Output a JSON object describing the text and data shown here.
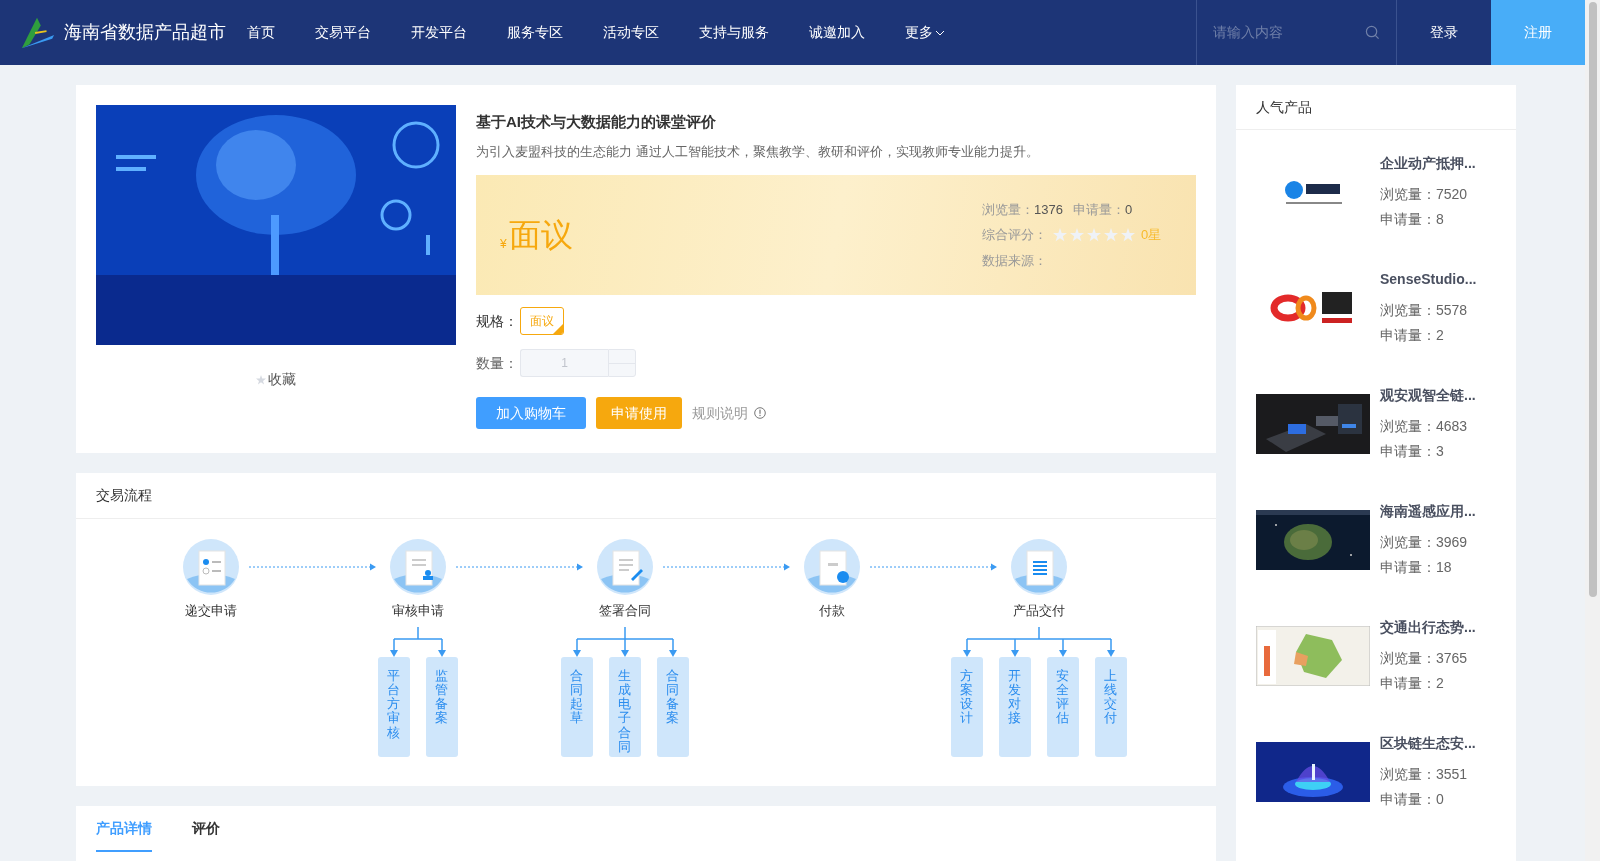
{
  "header": {
    "site_name": "海南省数据产品超市",
    "nav": [
      {
        "label": "首页",
        "has_caret": false
      },
      {
        "label": "交易平台",
        "has_caret": false
      },
      {
        "label": "开发平台",
        "has_caret": false
      },
      {
        "label": "服务专区",
        "has_caret": false
      },
      {
        "label": "活动专区",
        "has_caret": false
      },
      {
        "label": "支持与服务",
        "has_caret": false
      },
      {
        "label": "诚邀加入",
        "has_caret": false
      },
      {
        "label": "更多",
        "has_caret": true
      }
    ],
    "search": {
      "placeholder": "请输入内容"
    },
    "login": "登录",
    "register": "注册"
  },
  "product": {
    "title": "基于AI技术与大数据能力的课堂评价",
    "description": "为引入麦盟科技的生态能力 通过人工智能技术，聚焦教学、教研和评价，实现教师专业能力提升。",
    "price_symbol": "¥",
    "price": "面议",
    "views_label": "浏览量：",
    "views": "1376",
    "applies_label": "申请量：",
    "applies": "0",
    "rating_label": "综合评分：",
    "stars": 0,
    "rating_text": "0星",
    "source_label": "数据来源：",
    "spec_label": "规格：",
    "specs": [
      {
        "label": "面议",
        "selected": true
      }
    ],
    "quantity_label": "数量：",
    "quantity": "1",
    "favorite": "收藏",
    "buttons": [
      {
        "label": "加入购物车",
        "kind": "primary"
      },
      {
        "label": "申请使用",
        "kind": "warning"
      }
    ],
    "rules_link": "规则说明"
  },
  "flow": {
    "title": "交易流程",
    "steps": [
      {
        "label": "递交申请",
        "kind": "form"
      },
      {
        "label": "审核申请",
        "kind": "stamp",
        "children": [
          "平台方审核",
          "监管备案"
        ]
      },
      {
        "label": "签署合同",
        "kind": "pen",
        "children": [
          "合同起草",
          "生成电子合同",
          "合同备案"
        ]
      },
      {
        "label": "付款",
        "kind": "payment"
      },
      {
        "label": "产品交付",
        "kind": "list",
        "children": [
          "方案设计",
          "开发对接",
          "安全评估",
          "上线交付"
        ]
      }
    ]
  },
  "tabs": [
    {
      "label": "产品详情",
      "selected": true
    },
    {
      "label": "评价",
      "selected": false
    }
  ],
  "popular": {
    "title": "人气产品",
    "items": [
      {
        "name": "企业动产抵押...",
        "views": "浏览量：7520",
        "applies": "申请量：8"
      },
      {
        "name": "SenseStudio...",
        "views": "浏览量：5578",
        "applies": "申请量：2"
      },
      {
        "name": "观安观智全链...",
        "views": "浏览量：4683",
        "applies": "申请量：3"
      },
      {
        "name": "海南遥感应用...",
        "views": "浏览量：3969",
        "applies": "申请量：18"
      },
      {
        "name": "交通出行态势...",
        "views": "浏览量：3765",
        "applies": "申请量：2"
      },
      {
        "name": "区块链生态安...",
        "views": "浏览量：3551",
        "applies": "申请量：0"
      }
    ]
  }
}
